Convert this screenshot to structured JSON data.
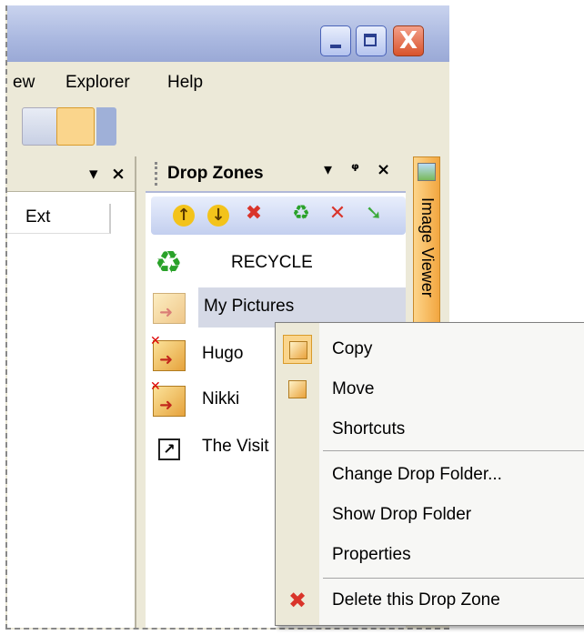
{
  "menu": {
    "partial_view": "ew",
    "explorer": "Explorer",
    "help": "Help"
  },
  "left_pane": {
    "column_ext": "Ext",
    "pin_glyph": "▾",
    "close_glyph": "×"
  },
  "drop_zones": {
    "title": "Drop Zones",
    "controls": {
      "dropdown": "▾",
      "pin": "ᵠ",
      "close": "×"
    },
    "toolbar": {
      "up": "↑",
      "down": "↓",
      "delete": "✖",
      "recycle": "♻",
      "remove": "✕",
      "go": "➘"
    },
    "items": [
      {
        "label": "RECYCLE",
        "icon": "recycle-icon"
      },
      {
        "label": "My Pictures",
        "icon": "folder-drop-icon",
        "selected": true
      },
      {
        "label": "Hugo",
        "icon": "folder-drop-icon"
      },
      {
        "label": "Nikki",
        "icon": "folder-drop-icon"
      },
      {
        "label": "The Visit",
        "icon": "shortcut-icon"
      }
    ]
  },
  "side_tab": {
    "label": "Image Viewer"
  },
  "context_menu": {
    "items": [
      {
        "label": "Copy"
      },
      {
        "label": "Move"
      },
      {
        "label": "Shortcuts"
      },
      {
        "label": "Change Drop Folder..."
      },
      {
        "label": "Show Drop Folder"
      },
      {
        "label": "Properties"
      },
      {
        "label": "Delete this Drop Zone"
      }
    ]
  },
  "window": {
    "minimize": "",
    "maximize": "",
    "close": "X"
  },
  "colors": {
    "accent": "#fad58c",
    "close_red": "#d9532c",
    "selection": "#d5d9e6"
  }
}
